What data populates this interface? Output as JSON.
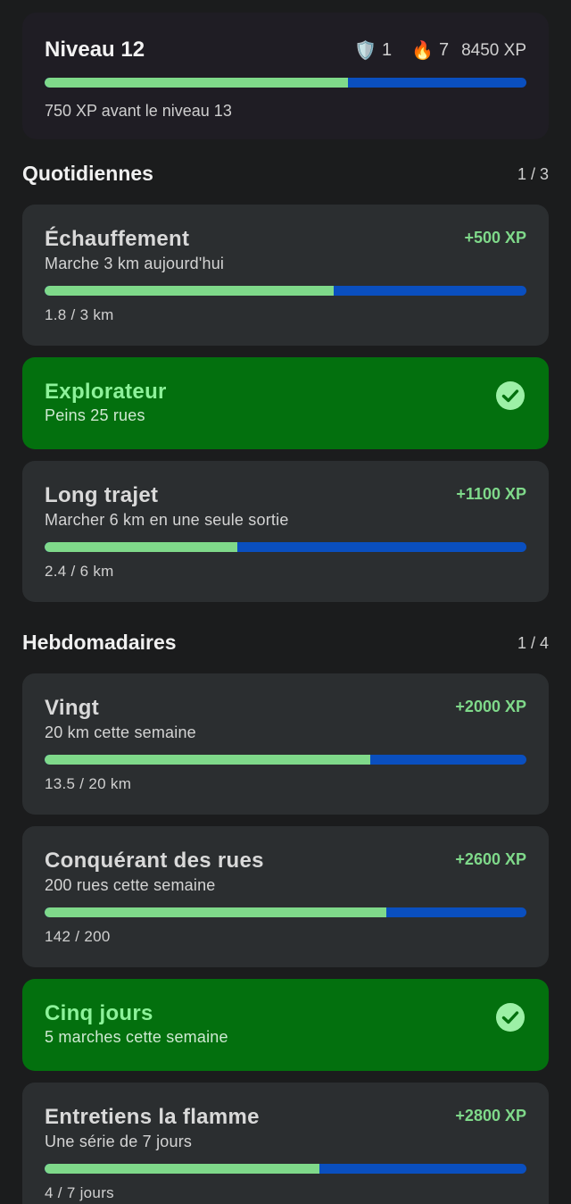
{
  "level": {
    "title": "Niveau 12",
    "shield_count": "1",
    "streak_count": "7",
    "total_xp": "8450 XP",
    "progress": 0.63,
    "subtitle": "750 XP avant le niveau 13",
    "icons": [
      "shield-icon",
      "fire-icon"
    ]
  },
  "daily": {
    "title": "Quotidiennes",
    "count": "1 / 3",
    "quests": [
      {
        "title": "Échauffement",
        "desc": "Marche 3 km aujourd'hui",
        "xp": "+500 XP",
        "progress_text": "1.8 / 3 km",
        "progress": 0.6,
        "done": false
      },
      {
        "title": "Explorateur",
        "desc": "Peins 25 rues",
        "done": true
      },
      {
        "title": "Long trajet",
        "desc": "Marcher 6 km en une seule sortie",
        "xp": "+1100 XP",
        "progress_text": "2.4 / 6 km",
        "progress": 0.4,
        "done": false
      }
    ]
  },
  "weekly": {
    "title": "Hebdomadaires",
    "count": "1 / 4",
    "quests": [
      {
        "title": "Vingt",
        "desc": "20 km cette semaine",
        "xp": "+2000 XP",
        "progress_text": "13.5 / 20 km",
        "progress": 0.675,
        "done": false
      },
      {
        "title": "Conquérant des rues",
        "desc": "200 rues cette semaine",
        "xp": "+2600 XP",
        "progress_text": "142 / 200",
        "progress": 0.71,
        "done": false
      },
      {
        "title": "Cinq jours",
        "desc": "5 marches cette semaine",
        "done": true
      },
      {
        "title": "Entretiens la flamme",
        "desc": "Une série de 7 jours",
        "xp": "+2800 XP",
        "progress_text": "4 / 7 jours",
        "progress": 0.571,
        "done": false
      }
    ]
  },
  "colors": {
    "background": "#1b1c1d",
    "card": "#2b2e30",
    "done_card": "#03700e",
    "progress_fill": "#7fd98a",
    "progress_track": "#0a4fbf",
    "xp_text": "#7fd98a",
    "done_title": "#8df29a"
  }
}
